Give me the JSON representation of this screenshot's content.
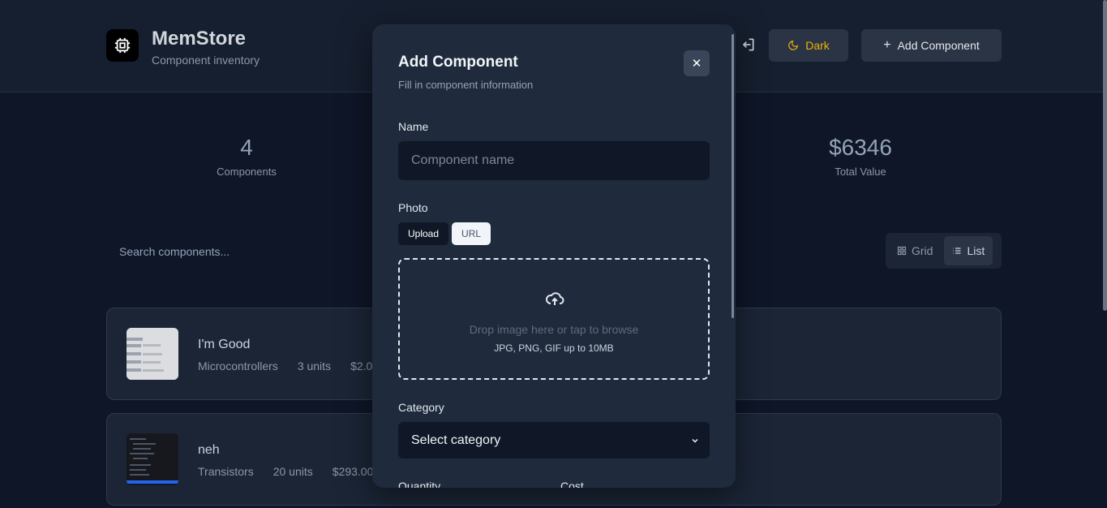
{
  "header": {
    "title": "MemStore",
    "subtitle": "Component inventory",
    "theme_label": "Dark",
    "add_label": "Add Component"
  },
  "stats": [
    {
      "value": "4",
      "label": "Components"
    },
    {
      "value": "$6346",
      "label": "Total Value"
    }
  ],
  "search": {
    "placeholder": "Search components..."
  },
  "view": {
    "grid_label": "Grid",
    "list_label": "List",
    "selected": "List"
  },
  "items": [
    {
      "name": "I'm Good",
      "category": "Microcontrollers",
      "units": "3 units",
      "price": "$2.0"
    },
    {
      "name": "neh",
      "category": "Transistors",
      "units": "20 units",
      "price": "$293.00"
    }
  ],
  "modal": {
    "title": "Add Component",
    "subtitle": "Fill in component information",
    "name_label": "Name",
    "name_placeholder": "Component name",
    "photo_label": "Photo",
    "upload_tab": "Upload",
    "url_tab": "URL",
    "drop_text": "Drop image here or tap to browse",
    "drop_hint": "JPG, PNG, GIF up to 10MB",
    "category_label": "Category",
    "category_value": "Select category",
    "quantity_label": "Quantity",
    "cost_label": "Cost"
  },
  "colors": {
    "accent_theme": "#eab308",
    "background": "#0f1628",
    "modal": "#1f2a3c"
  }
}
